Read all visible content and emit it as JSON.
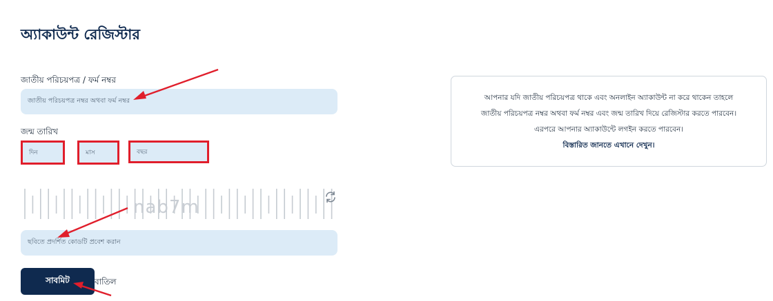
{
  "page_title": "অ্যাকাউন্ট রেজিস্টার",
  "nid_field": {
    "label": "জাতীয় পরিচয়পত্র / ফর্ম নম্বর",
    "placeholder": "জাতীয় পরিচয়পত্র নম্বর অথবা ফর্ম নম্বর"
  },
  "dob": {
    "label": "জন্ম তারিখ",
    "day": "দিন",
    "month": "মাস",
    "year": "বছর"
  },
  "captcha": {
    "watermark": "nab7m",
    "placeholder": "ছবিতে প্রদর্শিত কোডটি প্রবেশ করান",
    "refresh_icon": "refresh-icon"
  },
  "buttons": {
    "submit": "সাবমিট",
    "cancel": "বাতিল"
  },
  "info": {
    "line1": "আপনার যদি জাতীয় পরিচয়পত্র থাকে এবং অনলাইন অ্যাকাউন্ট না করে থাকেন তাহলে",
    "line2": "জাতীয় পরিচয়পত্র নম্বর অথবা ফর্ম নম্বর এবং জন্ম তারিখ দিয়ে রেজিস্টার করতে পারবেন।",
    "line3": "এরপরে আপনার অ্যাকাউন্টে লগইন করতে পারবেন।",
    "link": "বিস্তারিত জানতে এখানে দেখুন।"
  },
  "colors": {
    "primary": "#0f2a4f",
    "input_bg": "#dcebf7",
    "highlight": "#e01e2b"
  }
}
